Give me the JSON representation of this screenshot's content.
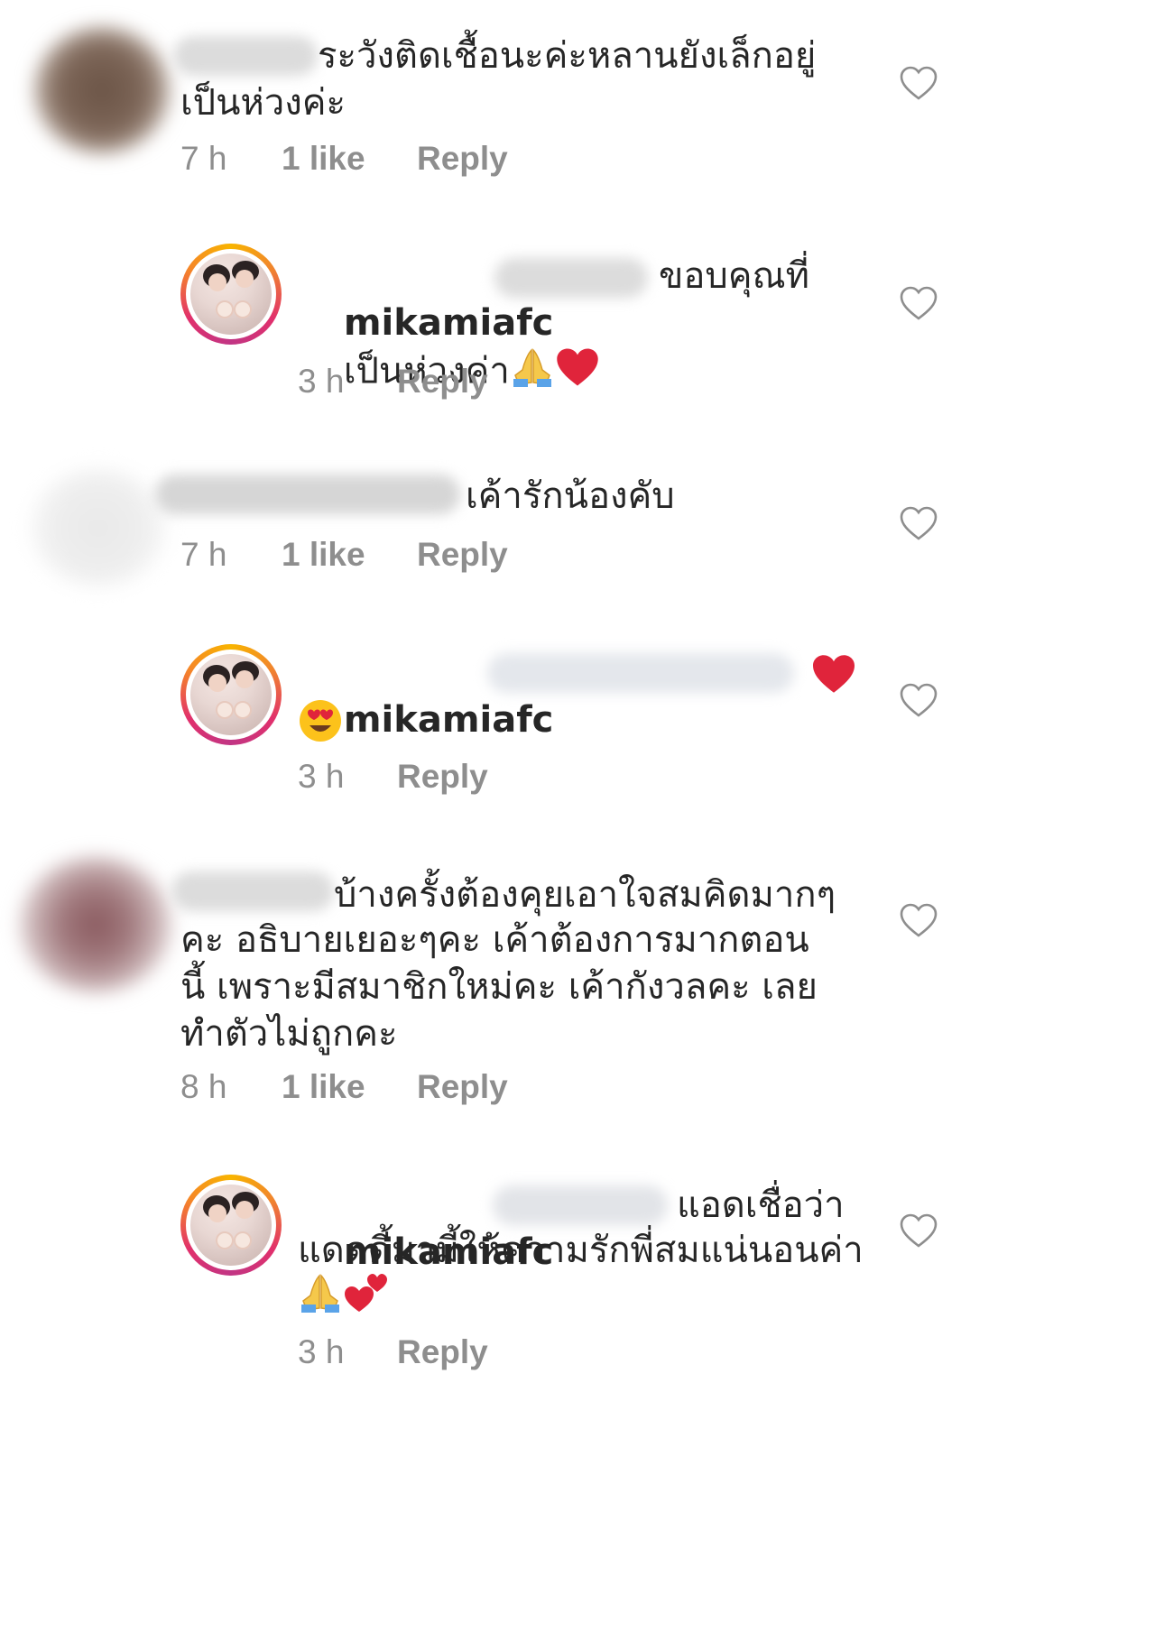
{
  "comments": [
    {
      "text": "ระวังติดเชื้อนะค่ะหลานยังเล็กอยู่\nเป็นห่วงค่ะ",
      "time": "7 h",
      "likes": "1 like",
      "reply": "Reply"
    },
    {
      "username": "mikamiafc",
      "text_line1": "ขอบคุณที่",
      "text_line2": "เป็นห่วงค่า",
      "time": "3 h",
      "reply": "Reply"
    },
    {
      "text": "เค้ารักน้องคับ",
      "time": "7 h",
      "likes": "1 like",
      "reply": "Reply"
    },
    {
      "username": "mikamiafc",
      "time": "3 h",
      "reply": "Reply"
    },
    {
      "text_line1": "บ้างครั้งต้องคุยเอาใจสมคิดมากๆ",
      "text_rest": "คะ อธิบายเยอะๆคะ เค้าต้องการมากตอน\nนี้ เพราะมีสมาชิกใหม่คะ เค้ากังวลคะ เลย\nทำตัวไม่ถูกคะ",
      "time": "8 h",
      "likes": "1 like",
      "reply": "Reply"
    },
    {
      "username": "mikamiafc",
      "text_line1": "แอดเชื่อว่า",
      "text_line2": "แดดดี้มามี้ให้ความรักพี่สมแน่นอนค่า",
      "time": "3 h",
      "reply": "Reply"
    }
  ],
  "icons": {
    "like": "heart-outline-icon",
    "emojis": [
      "folded-hands-emoji",
      "red-heart-emoji",
      "heart-eyes-emoji",
      "two-hearts-emoji"
    ]
  },
  "colors": {
    "meta_text": "#8e8e8e",
    "heart_red": "#e0243b"
  }
}
